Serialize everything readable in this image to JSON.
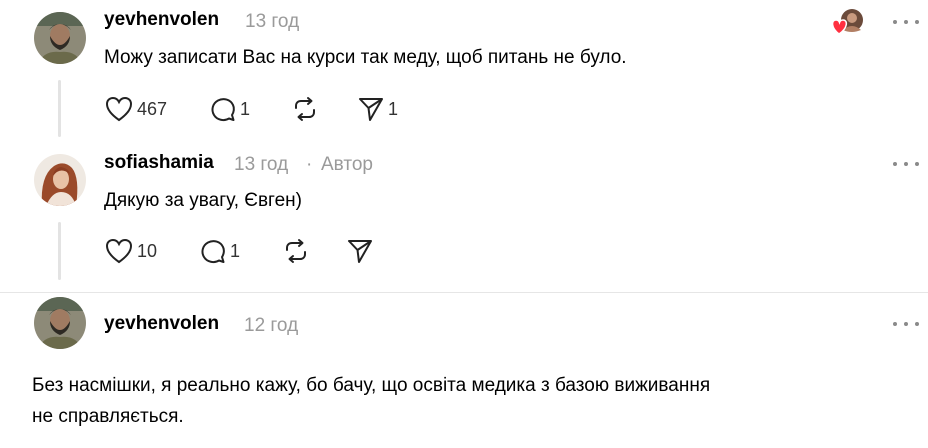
{
  "comments": [
    {
      "username": "yevhenvolen",
      "time": "13 год",
      "text": "Можу записати Вас на курси так меду, щоб питань не було.",
      "likes": "467",
      "replies": "1",
      "shares": "1"
    },
    {
      "username": "sofiashamia",
      "time": "13 год",
      "separator": "·",
      "badge": "Автор",
      "text": "Дякую за увагу, Євген)",
      "likes": "10",
      "replies": "1"
    },
    {
      "username": "yevhenvolen",
      "time": "12 год",
      "text_line1": "Без насмішки, я реально кажу, бо бачу, що освіта медика з базою виживання",
      "text_line2": "не справляється."
    }
  ],
  "icons": {
    "like": "heart-icon",
    "reply": "comment-icon",
    "repost": "repost-icon",
    "share": "send-icon",
    "more": "more-icon",
    "liked_by_author": "author-liked-heart-icon"
  },
  "colors": {
    "heart_red": "#ff3040",
    "muted": "#9a9a9a",
    "line": "#e3e3e3"
  }
}
